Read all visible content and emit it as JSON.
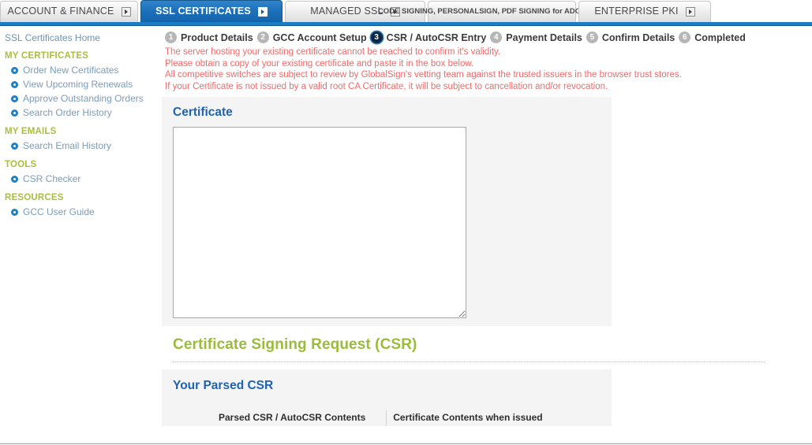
{
  "tabs": [
    {
      "label": "ACCOUNT & FINANCE",
      "active": false,
      "icon": "dropdown-icon",
      "two_line": false
    },
    {
      "label": "SSL CERTIFICATES",
      "active": true,
      "icon": "dropdown-icon",
      "two_line": false
    },
    {
      "label": "MANAGED SSL",
      "active": false,
      "icon": "dropdown-icon",
      "two_line": false
    },
    {
      "label": "CODE SIGNING, PERSONALSIGN, PDF SIGNING for ADOBE CDS",
      "active": false,
      "icon": "dropdown-icon",
      "two_line": true
    },
    {
      "label": "ENTERPRISE PKI",
      "active": false,
      "icon": "dropdown-icon",
      "two_line": false
    }
  ],
  "sidebar": {
    "home_label": "SSL Certificates Home",
    "groups": [
      {
        "title": "MY CERTIFICATES",
        "items": [
          {
            "label": "Order New Certificates"
          },
          {
            "label": "View Upcoming Renewals"
          },
          {
            "label": "Approve Outstanding Orders"
          },
          {
            "label": "Search Order History"
          }
        ]
      },
      {
        "title": "MY EMAILS",
        "items": [
          {
            "label": "Search Email History"
          }
        ]
      },
      {
        "title": "TOOLS",
        "items": [
          {
            "label": "CSR Checker"
          }
        ]
      },
      {
        "title": "RESOURCES",
        "items": [
          {
            "label": "GCC User Guide"
          }
        ]
      }
    ]
  },
  "steps": [
    {
      "num": "1",
      "label": "Product Details",
      "current": false
    },
    {
      "num": "2",
      "label": "GCC Account Setup",
      "current": false
    },
    {
      "num": "3",
      "label": "CSR / AutoCSR Entry",
      "current": true
    },
    {
      "num": "4",
      "label": "Payment Details",
      "current": false
    },
    {
      "num": "5",
      "label": "Confirm Details",
      "current": false
    },
    {
      "num": "6",
      "label": "Completed",
      "current": false
    }
  ],
  "warning": {
    "line1": "The server hosting your existing certificate cannot be reached to confirm it's validity.",
    "line2": "Please obtain a copy of your existing certificate and paste it in the box below.",
    "line3": "All competitive switches are subject to review by GlobalSign's vetting team against the trusted issuers in the browser trust stores.",
    "line4": "If your Certificate is not issued by a valid root CA Certificate, it will be subject to cancellation and/or revocation."
  },
  "certificate_section": {
    "title": "Certificate",
    "textarea_value": "",
    "textarea_placeholder": ""
  },
  "csr_section": {
    "title": "Certificate Signing Request (CSR)",
    "parsed_title": "Your Parsed CSR",
    "table_headers": [
      "Parsed CSR / AutoCSR Contents",
      "Certificate Contents when issued"
    ]
  },
  "colors": {
    "accent_blue": "#1b7ec4",
    "active_tab_blue": "#1c6fb8",
    "heading_blue": "#1f63b0",
    "heading_green": "#9bbb3c",
    "sidebar_head_olive": "#a8bf3f",
    "sidebar_link": "#7b9cba",
    "warning_red": "#f06a6a",
    "panel_gray": "#f4f4f4",
    "step_inactive": "#b6b6b6",
    "step_active": "#0d2744"
  }
}
